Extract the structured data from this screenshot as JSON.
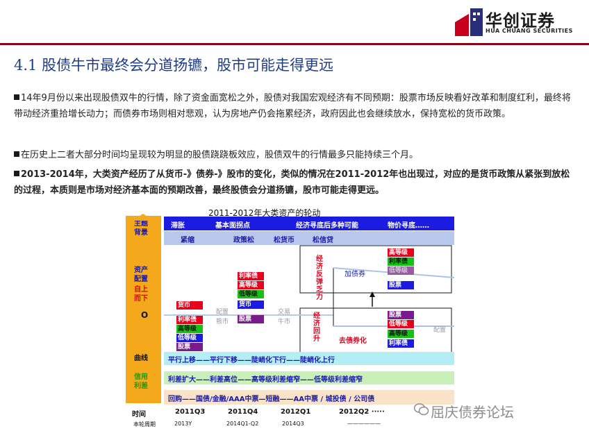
{
  "brand": {
    "name_cn": "华创证券",
    "name_en": "HUA CHUANG SECURITIES",
    "color_dark_red": "#8b0010",
    "color_title_blue": "#1f3c88"
  },
  "title": "4.1 股债牛市最终会分道扬镳，股市可能走得更远",
  "paragraphs": [
    "14年9月份以来出现股债双牛的行情，除了资金面宽松之外，股债对我国宏观经济有不同预期：股票市场反映看好改革和制度红利，最终将带动经济重拾增长动力；而债券市场则相对悲观，认为房地产仍会拖累经济，政府因此也会继续放水，保持宽松的货币政策。",
    "在历史上二者大部分时间均呈现较为明显的股债跷跷板效应，股债双牛的行情最多只能持续三个月。",
    "2013-2014年，大类资产经历了从货币-》债券-》股市的变化，类似的情况在2011-2012年也出现过，对应的是货币政策从紧张到放松的过程，本质则是市场对经济基本面的预期改善，最终股债会分道扬镳，股市可能走得更远。"
  ],
  "diagram": {
    "title": "2011-2012年大类资产的轮动",
    "left_labels": {
      "theme": "主题背景",
      "allocation": "资产配置",
      "topdown": "自上而下",
      "zero": "O",
      "curve": "曲线",
      "credit": "信用利差",
      "time": "时间",
      "cycle": "本轮周期"
    },
    "row_blue": [
      "滞胀",
      "基本面拐点",
      "经济寻底后多种可能",
      "物价寻底……"
    ],
    "row_policy": [
      "紧缩",
      "政策松",
      "松货币",
      "松信贷"
    ],
    "stage1": [
      "货币",
      "利率债",
      "高等级",
      "低等级",
      "股票"
    ],
    "stage2": [
      "利率债",
      "高等级",
      "低等级",
      "货币",
      "股票"
    ],
    "axis_words": [
      "配置",
      "熊市",
      "交易",
      "牛市"
    ],
    "upper_box": {
      "side": "经济反弹乏力",
      "label": "加债券",
      "chips": [
        "高等级",
        "利率债",
        "低等级",
        "股票"
      ]
    },
    "lower_box": {
      "side": "经济回升",
      "label": "去债券化",
      "chips": [
        "股票",
        "低等级",
        "高等级",
        "利率债"
      ],
      "right_word": "配置"
    },
    "curve_row": "平行上移——平行下移——陡峭化下行——陡峭化上行",
    "credit_row": "利差扩大——利差高位——高等级利差缩窄——低等级利差缩窄",
    "product_row": "回购——国债/金融/AAA中票—短融——AA中票 / 城投债 / 公司债",
    "time_points": [
      "2011Q3",
      "2011Q4",
      "2012Q1",
      "2012Q2 ·····"
    ],
    "cycle_points": [
      "2013Y",
      "2014Q1-Q2",
      "2014Q3",
      "——————"
    ]
  },
  "watermark": "屈庆债券论坛",
  "chip_colors": {
    "red": "#e8001c",
    "green": "#16c016",
    "blue": "#1c1ce0",
    "purple": "#7a1a8c"
  }
}
